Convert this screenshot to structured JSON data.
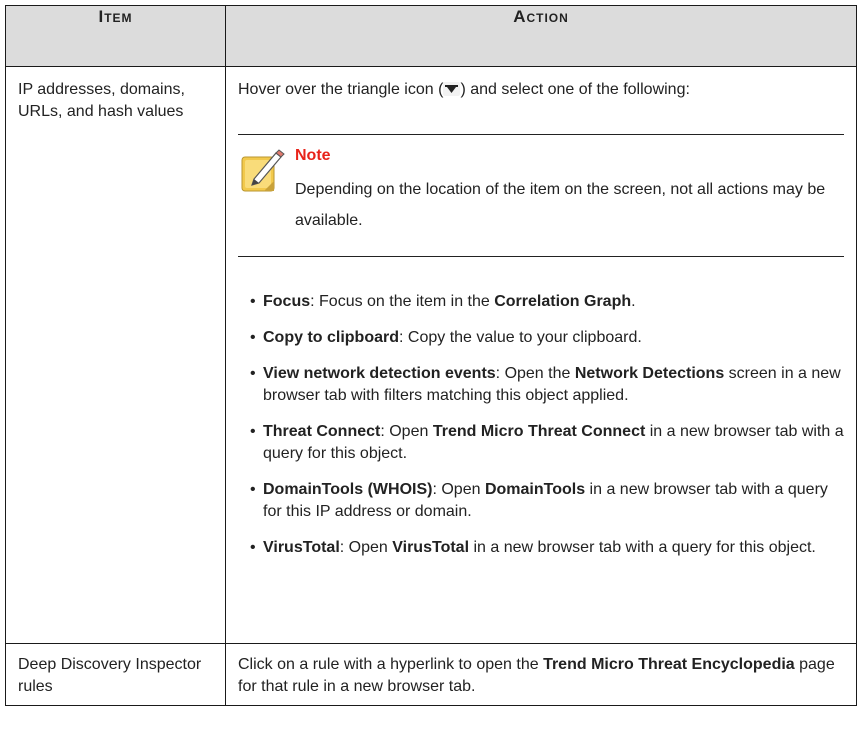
{
  "table": {
    "headers": [
      "Item",
      "Action"
    ],
    "rows": [
      {
        "item": "IP addresses, domains, URLs, and hash values",
        "hover_before": "Hover over the triangle icon (",
        "hover_after": ") and select one of the following:",
        "note": {
          "title": "Note",
          "text": "Depending on the location of the item on the screen, not all actions may be available."
        },
        "actions": [
          {
            "name": "Focus",
            "t1": ": Focus on the item in the ",
            "b1": "Correlation Graph",
            "t2": "."
          },
          {
            "name": "Copy to clipboard",
            "t1": ": Copy the value to your clipboard."
          },
          {
            "name": "View network detection events",
            "t1": ": Open the ",
            "b1": "Network Detections",
            "t2": " screen in a new browser tab with filters matching this object applied."
          },
          {
            "name": "Threat Connect",
            "t1": ": Open ",
            "b1": "Trend Micro Threat Connect",
            "t2": " in a new browser tab with a query for this object."
          },
          {
            "name": "DomainTools (WHOIS)",
            "t1": ": Open ",
            "b1": "DomainTools",
            "t2": " in a new browser tab with a query for this IP address or domain."
          },
          {
            "name": "VirusTotal",
            "t1": ": Open ",
            "b1": "VirusTotal",
            "t2": " in a new browser tab with a query for this object."
          }
        ]
      },
      {
        "item": "Deep Discovery Inspector rules",
        "t1": "Click on a rule with a hyperlink to open the ",
        "b1": "Trend Micro Threat Encyclopedia",
        "t2": " page for that rule in a new browser tab."
      }
    ]
  },
  "icons": {
    "triangle": "triangle-down-icon",
    "note": "note-pencil-icon"
  },
  "colors": {
    "header_bg": "#dcdcdc",
    "note_title": "#e8231a",
    "note_icon": "#f2c94c"
  }
}
